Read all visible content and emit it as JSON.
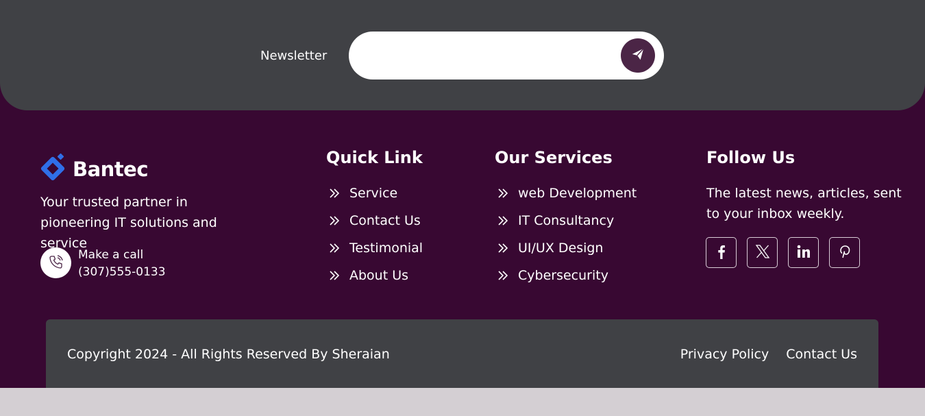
{
  "newsletter": {
    "label": "Newsletter",
    "input_value": "",
    "placeholder": "",
    "submit_icon": "paper-plane-icon"
  },
  "brand": {
    "name": "Bantec",
    "logo_icon": "diamond-logo-icon",
    "tagline": "Your trusted partner in pioneering IT solutions and service"
  },
  "contact": {
    "icon": "phone-icon",
    "label": "Make a call",
    "phone": "(307)555-0133"
  },
  "quick_links": {
    "title": "Quick Link",
    "items": [
      {
        "label": "Service"
      },
      {
        "label": "Contact Us"
      },
      {
        "label": "Testimonial"
      },
      {
        "label": "About Us"
      }
    ]
  },
  "services": {
    "title": "Our Services",
    "items": [
      {
        "label": "web Development"
      },
      {
        "label": "IT Consultancy"
      },
      {
        "label": "UI/UX Design"
      },
      {
        "label": "Cybersecurity"
      }
    ]
  },
  "follow": {
    "title": "Follow Us",
    "text": "The latest news, articles, sent to your inbox weekly.",
    "socials": [
      "facebook-icon",
      "x-twitter-icon",
      "linkedin-icon",
      "pinterest-icon"
    ]
  },
  "bottom": {
    "copyright": "Copyright 2024 - All Rights Reserved By Sheraian",
    "links": [
      {
        "label": "Privacy Policy"
      },
      {
        "label": "Contact Us"
      }
    ]
  },
  "colors": {
    "footer_bg": "#380832",
    "panel_bg": "#404145",
    "accent": "#4b2546",
    "logo_blue": "#2f6fe8"
  }
}
